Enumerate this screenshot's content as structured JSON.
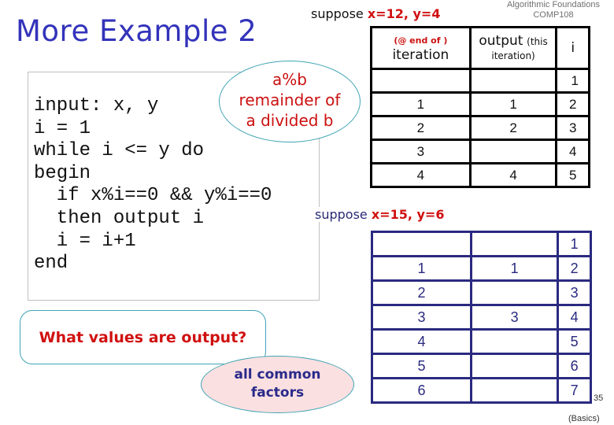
{
  "slide": {
    "title": "More Example 2",
    "course": {
      "line1": "Algorithmic Foundations",
      "line2": "COMP108"
    },
    "page_number": "35",
    "section": "(Basics)"
  },
  "code": {
    "lines": [
      "input: x, y",
      "i = 1",
      "while i <= y do",
      "begin",
      "  if x%i==0 && y%i==0",
      "  then output i",
      "  i = i+1",
      "end"
    ]
  },
  "callouts": {
    "modulo_note": {
      "line1": "a%b",
      "line2": "remainder of",
      "line3": "a divided b"
    },
    "question": "What values are output?",
    "answer": {
      "line1": "all common",
      "line2": "factors"
    }
  },
  "trace_headers": {
    "iteration_small": "(@ end of )",
    "iteration": "iteration",
    "output": "output",
    "output_small": "(this",
    "output_small2": "iteration)",
    "i": "i"
  },
  "example1": {
    "label": "suppose",
    "values": "x=12, y=4",
    "colors": {
      "border": "#000000",
      "text": "#111111"
    },
    "rows": [
      {
        "iteration": "",
        "output": "",
        "i": "1"
      },
      {
        "iteration": "1",
        "output": "1",
        "i": "2"
      },
      {
        "iteration": "2",
        "output": "2",
        "i": "3"
      },
      {
        "iteration": "3",
        "output": "",
        "i": "4"
      },
      {
        "iteration": "4",
        "output": "4",
        "i": "5"
      }
    ]
  },
  "example2": {
    "label": "suppose",
    "values": "x=15, y=6",
    "colors": {
      "border": "#2a2a80",
      "text": "#2a2a80"
    },
    "rows": [
      {
        "iteration": "",
        "output": "",
        "i": "1"
      },
      {
        "iteration": "1",
        "output": "1",
        "i": "2"
      },
      {
        "iteration": "2",
        "output": "",
        "i": "3"
      },
      {
        "iteration": "3",
        "output": "3",
        "i": "4"
      },
      {
        "iteration": "4",
        "output": "",
        "i": "5"
      },
      {
        "iteration": "5",
        "output": "",
        "i": "6"
      },
      {
        "iteration": "6",
        "output": "",
        "i": "7"
      }
    ]
  },
  "colors": {
    "title": "#3333bb",
    "highlight": "#d01010",
    "callout_border": "#3fa4b4",
    "answer_fill": "#fbe0e2"
  }
}
